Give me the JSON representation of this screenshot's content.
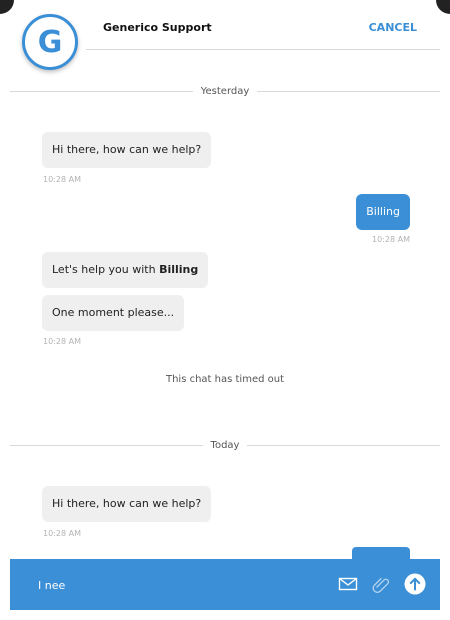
{
  "header": {
    "avatar_letter": "G",
    "title": "Generico Support",
    "cancel_label": "CANCEL"
  },
  "conversation": {
    "yesterday": {
      "label": "Yesterday",
      "msg1": "Hi there, how can we help?",
      "time1": "10:28 AM",
      "user_msg": "Billing",
      "user_time": "10:28 AM",
      "msg2_prefix": "Let's help you with ",
      "msg2_bold": "Billing",
      "msg3": "One moment please...",
      "time3": "10:28 AM",
      "status": "This chat has timed out"
    },
    "today": {
      "label": "Today",
      "msg1": "Hi there, how can we help?",
      "time1": "10:28 AM"
    }
  },
  "composer": {
    "value": "I nee",
    "icons": [
      "envelope-icon",
      "paperclip-icon",
      "send-arrow-icon"
    ]
  },
  "colors": {
    "accent": "#3a8fd6",
    "agent_bubble": "#efefef",
    "divider": "#d9d9d9"
  }
}
